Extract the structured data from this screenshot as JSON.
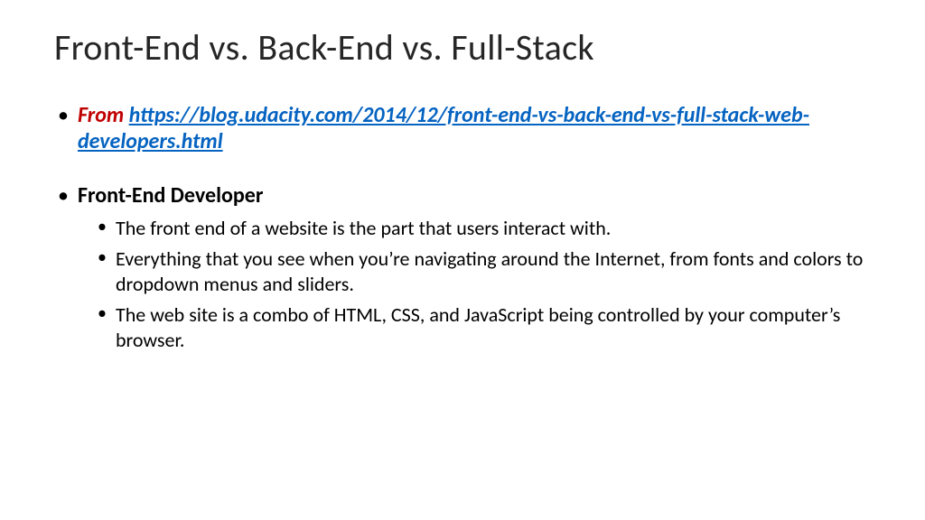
{
  "title": "Front-End vs. Back-End vs. Full-Stack",
  "source": {
    "label": "From",
    "url_text": "https://blog.udacity.com/2014/12/front-end-vs-back-end-vs-full-stack-web-developers.html"
  },
  "section": {
    "heading": "Front-End Developer",
    "points": [
      "The front end of a website is the part that users interact with.",
      "Everything that you see when you’re navigating around the Internet, from fonts and colors to dropdown menus and sliders.",
      "The web site is a combo of HTML, CSS, and JavaScript being controlled by your computer’s browser."
    ]
  }
}
